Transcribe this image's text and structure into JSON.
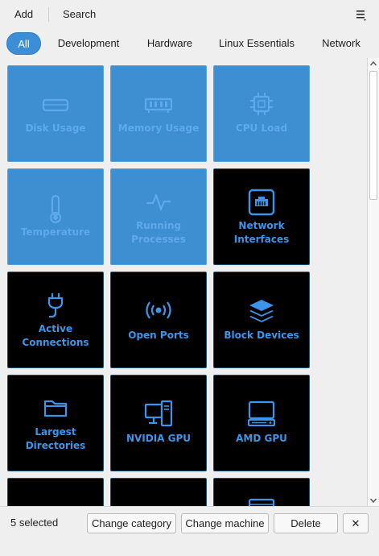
{
  "toolbar": {
    "add_label": "Add",
    "search_label": "Search",
    "menu_icon": "hamburger-menu-icon"
  },
  "tabs": [
    {
      "label": "All",
      "active": true
    },
    {
      "label": "Development",
      "active": false
    },
    {
      "label": "Hardware",
      "active": false
    },
    {
      "label": "Linux Essentials",
      "active": false
    },
    {
      "label": "Network",
      "active": false
    }
  ],
  "tiles": [
    {
      "label": "Disk Usage",
      "icon": "disk-icon",
      "selected": true
    },
    {
      "label": "Memory Usage",
      "icon": "memory-icon",
      "selected": true
    },
    {
      "label": "CPU Load",
      "icon": "cpu-icon",
      "selected": true
    },
    {
      "label": "Temperature",
      "icon": "thermometer-icon",
      "selected": true
    },
    {
      "label": "Running Processes",
      "icon": "pulse-icon",
      "selected": true
    },
    {
      "label": "Network Interfaces",
      "icon": "ethernet-port-icon",
      "selected": false
    },
    {
      "label": "Active Connections",
      "icon": "plug-icon",
      "selected": false
    },
    {
      "label": "Open Ports",
      "icon": "broadcast-icon",
      "selected": false
    },
    {
      "label": "Block Devices",
      "icon": "layers-icon",
      "selected": false
    },
    {
      "label": "Largest Directories",
      "icon": "folder-icon",
      "selected": false
    },
    {
      "label": "NVIDIA GPU",
      "icon": "desktop-tower-icon",
      "selected": false
    },
    {
      "label": "AMD GPU",
      "icon": "monitor-icon",
      "selected": false
    }
  ],
  "footer": {
    "status": "5 selected",
    "change_category_label": "Change category",
    "change_machine_label": "Change machine",
    "delete_label": "Delete",
    "close_label": "✕"
  },
  "colors": {
    "accent": "#3c8fd6",
    "selected_tile": "#3e8fd2",
    "tile_bg": "#000000",
    "tile_text": "#3d95ea"
  }
}
